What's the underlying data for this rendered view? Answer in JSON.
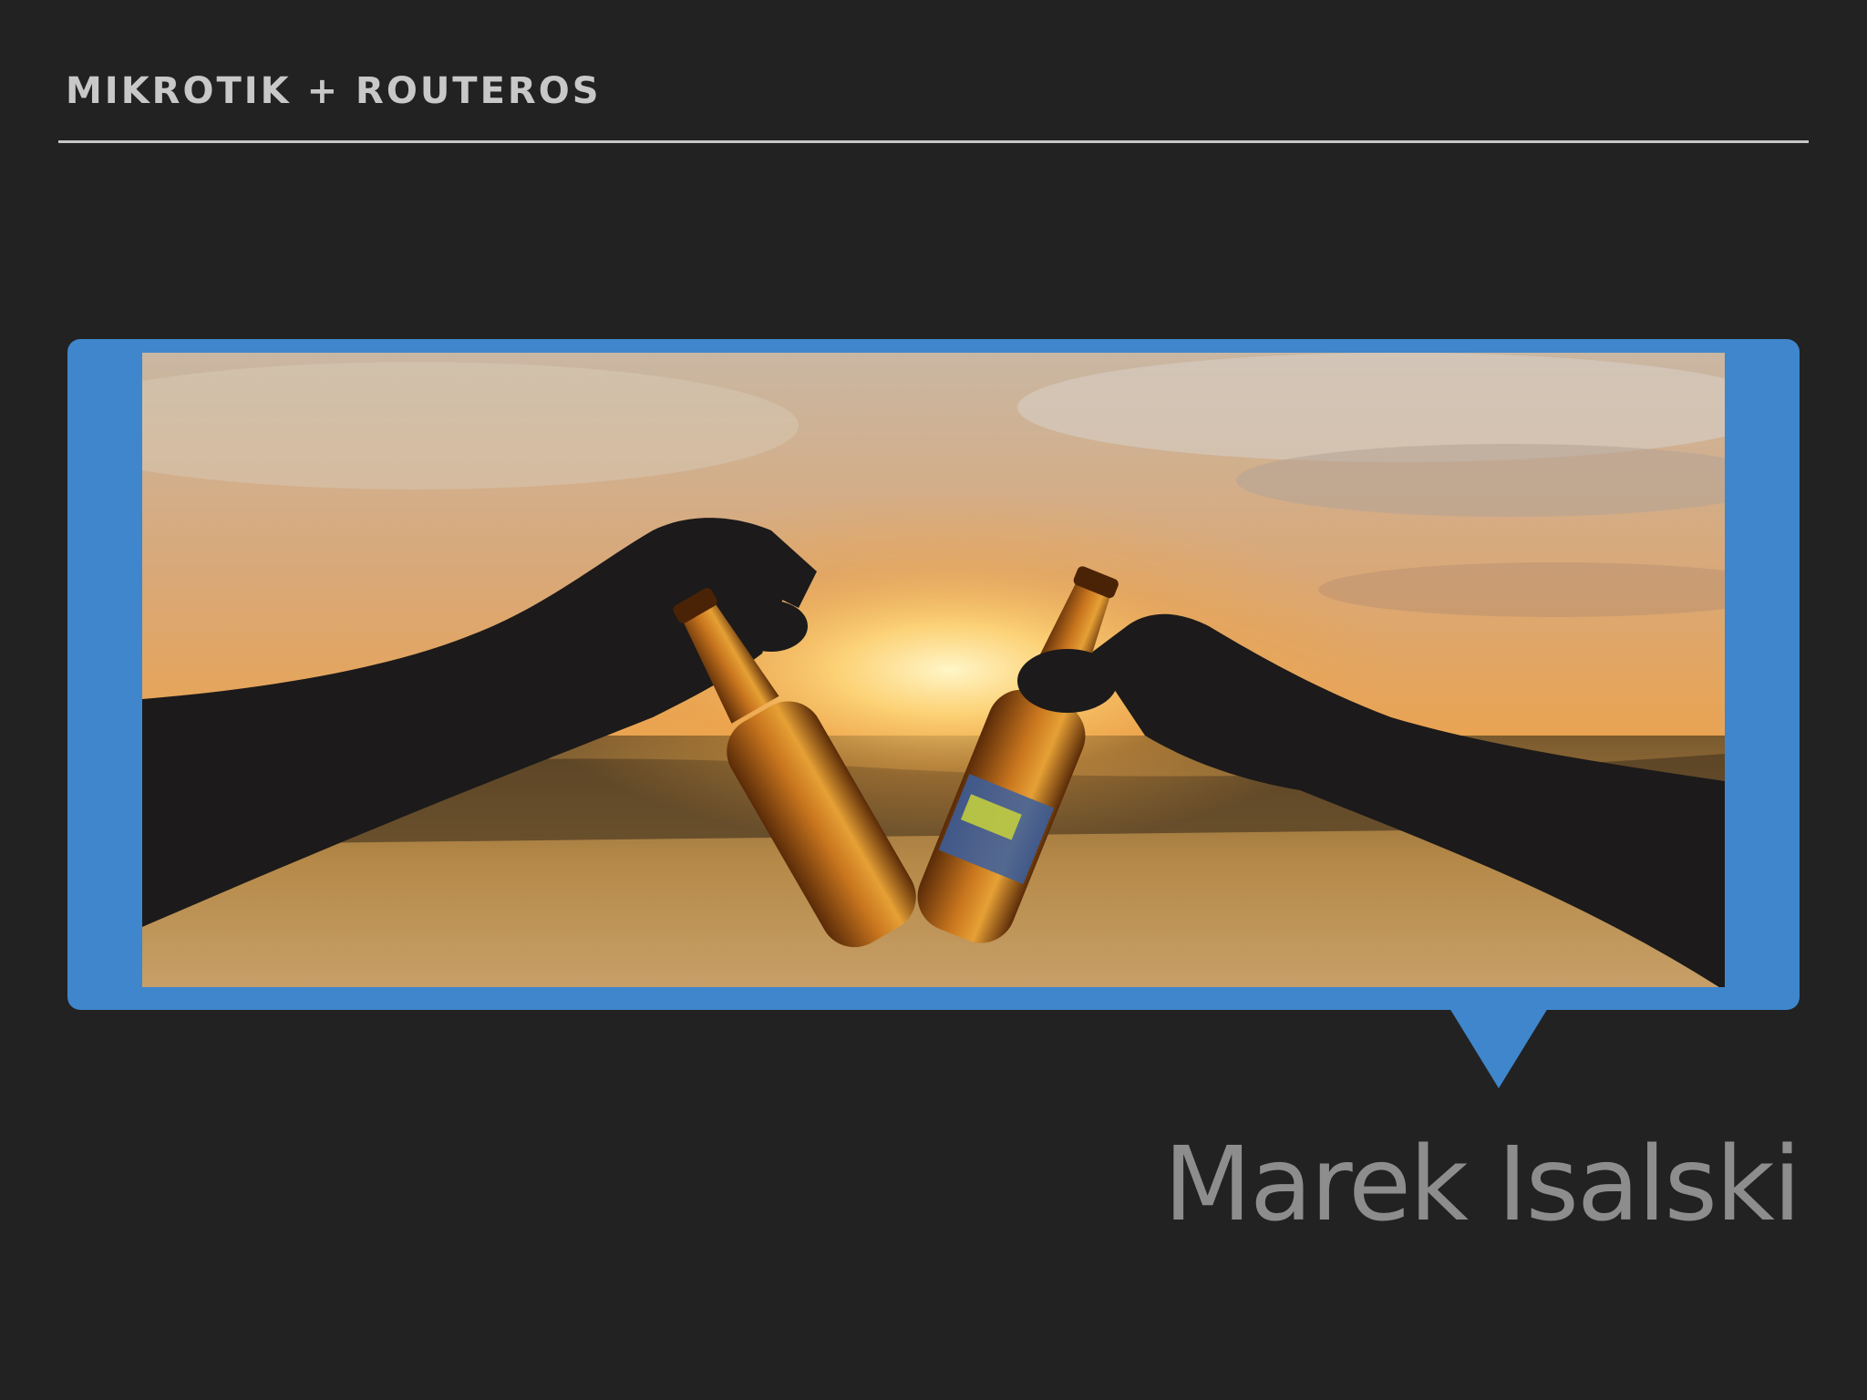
{
  "header": {
    "title": "MIKROTIK + ROUTEROS"
  },
  "photo": {
    "subject": "two-hands-toasting-beer-bottles-at-sunset",
    "frame_color": "#3f86cc"
  },
  "footer": {
    "author": "Marek Isalski"
  },
  "colors": {
    "background": "#222222",
    "accent": "#3f86cc",
    "rule": "#c6c6c6",
    "title_text": "#c8c8c8",
    "author_text": "#8d8d8d"
  }
}
